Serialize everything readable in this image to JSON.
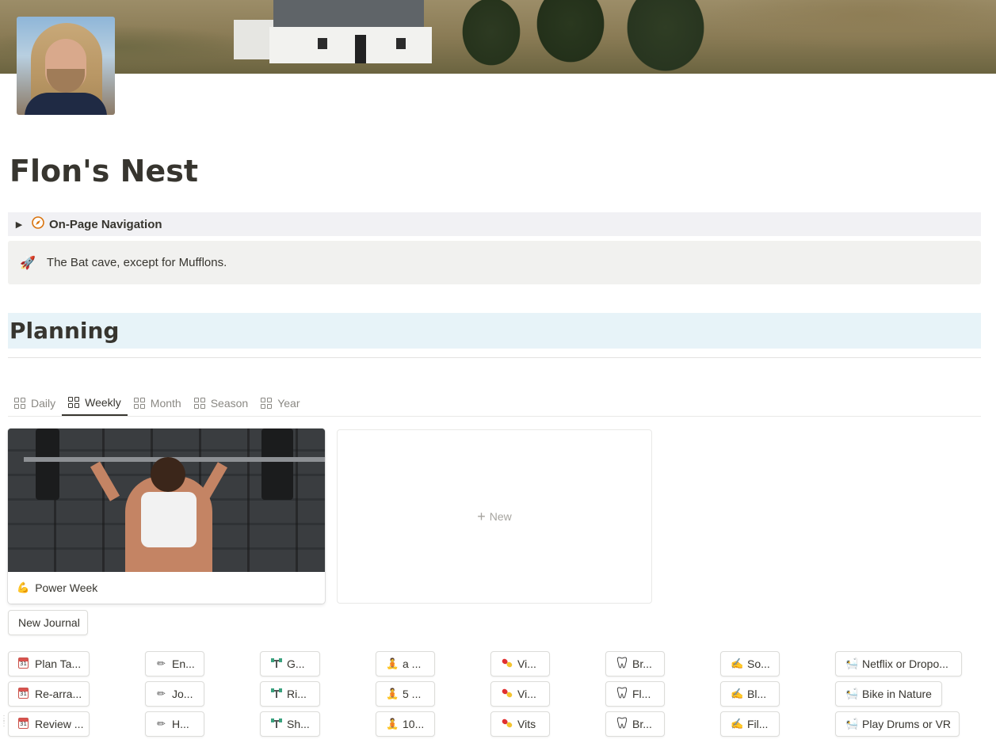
{
  "page": {
    "title": "Flon's Nest"
  },
  "toggle": {
    "icon": "compass-icon",
    "label": "On-Page Navigation"
  },
  "callout": {
    "icon": "rocket-icon",
    "text": "The Bat cave, except for Mufflons."
  },
  "planning": {
    "heading": "Planning",
    "tabs": [
      {
        "label": "Daily",
        "active": false
      },
      {
        "label": "Weekly",
        "active": true
      },
      {
        "label": "Month",
        "active": false
      },
      {
        "label": "Season",
        "active": false
      },
      {
        "label": "Year",
        "active": false
      }
    ],
    "cards": [
      {
        "emoji": "💪",
        "title": "Power Week"
      }
    ],
    "new_label": "New"
  },
  "new_journal_label": "New Journal",
  "button_grid": {
    "columns": [
      {
        "icon": "calendar-icon",
        "items": [
          "Plan Ta...",
          "Re-arra...",
          "Review ..."
        ]
      },
      {
        "icon": "pencil-icon",
        "items": [
          "En...",
          "Jo...",
          "H..."
        ]
      },
      {
        "icon": "dumbbell-icon",
        "items": [
          "G...",
          "Ri...",
          "Sh..."
        ]
      },
      {
        "icon": "meditation-icon",
        "items": [
          "a ...",
          "5 ...",
          "10..."
        ]
      },
      {
        "icon": "pill-icon",
        "items": [
          "Vi...",
          "Vi...",
          "Vits"
        ]
      },
      {
        "icon": "tooth-icon",
        "items": [
          "Br...",
          "Fl...",
          "Br..."
        ]
      },
      {
        "icon": "writing-hand-icon",
        "items": [
          "So...",
          "Bl...",
          "Fil..."
        ]
      },
      {
        "icon": "bathtub-icon",
        "items": [
          "Netflix or Dropo...",
          "Bike in Nature",
          "Play Drums or VR"
        ]
      }
    ]
  }
}
